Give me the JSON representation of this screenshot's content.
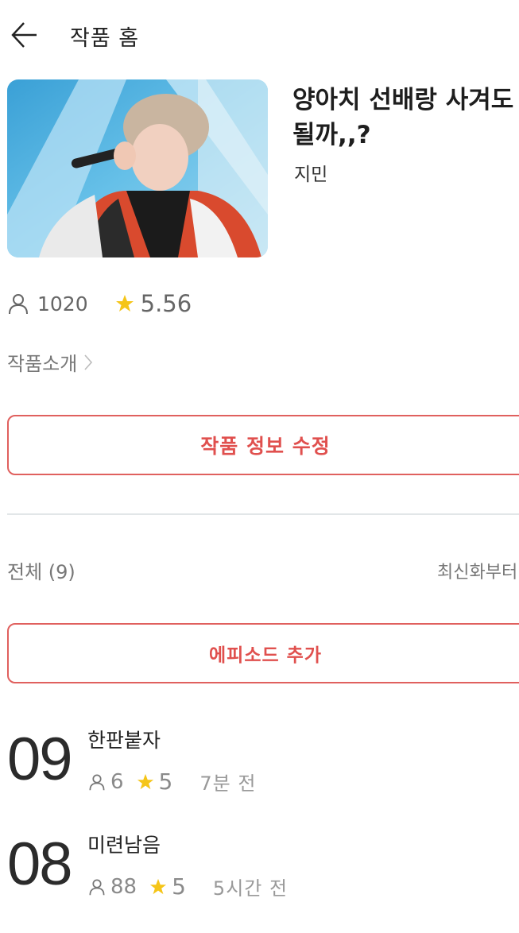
{
  "header": {
    "title": "작품 홈",
    "back_icon": "arrow-left-icon"
  },
  "work": {
    "title": "양아치 선배랑 사겨도 될까,,?",
    "author": "지민",
    "views": "1020",
    "rating": "5.56",
    "intro_label": "작품소개"
  },
  "actions": {
    "edit_label": "작품 정보 수정",
    "add_episode_label": "에피소드 추가"
  },
  "list": {
    "total_label": "전체 (9)",
    "sort_label": "최신화부터"
  },
  "episodes": [
    {
      "number": "09",
      "title": "한판붙자",
      "views": "6",
      "rating": "5",
      "time": "7분 전"
    },
    {
      "number": "08",
      "title": "미련남음",
      "views": "88",
      "rating": "5",
      "time": "5시간 전"
    }
  ],
  "colors": {
    "accent": "#e0504e",
    "star": "#f5c518",
    "divider": "#e2e6e8"
  }
}
